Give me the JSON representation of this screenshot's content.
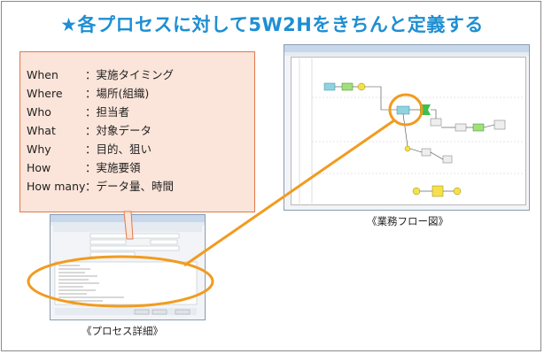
{
  "title": "★各プロセスに対して5W2Hをきちんと定義する",
  "definitions": [
    {
      "key": "When",
      "value": "：実施タイミング"
    },
    {
      "key": "Where",
      "value": "：場所(組織)"
    },
    {
      "key": "Who",
      "value": "：担当者"
    },
    {
      "key": "What",
      "value": "：対象データ"
    },
    {
      "key": "Why",
      "value": "：目的、狙い"
    },
    {
      "key": "How",
      "value": "：実施要領"
    },
    {
      "key": "How many",
      "value": "：データ量、時間"
    }
  ],
  "captions": {
    "flow": "《業務フロー図》",
    "detail": "《プロセス詳細》"
  },
  "colors": {
    "title": "#1e8fd2",
    "box_fill": "#fbe4d9",
    "box_border": "#e07a4a",
    "highlight": "#f29b1f",
    "connector": "#f29b1f"
  }
}
